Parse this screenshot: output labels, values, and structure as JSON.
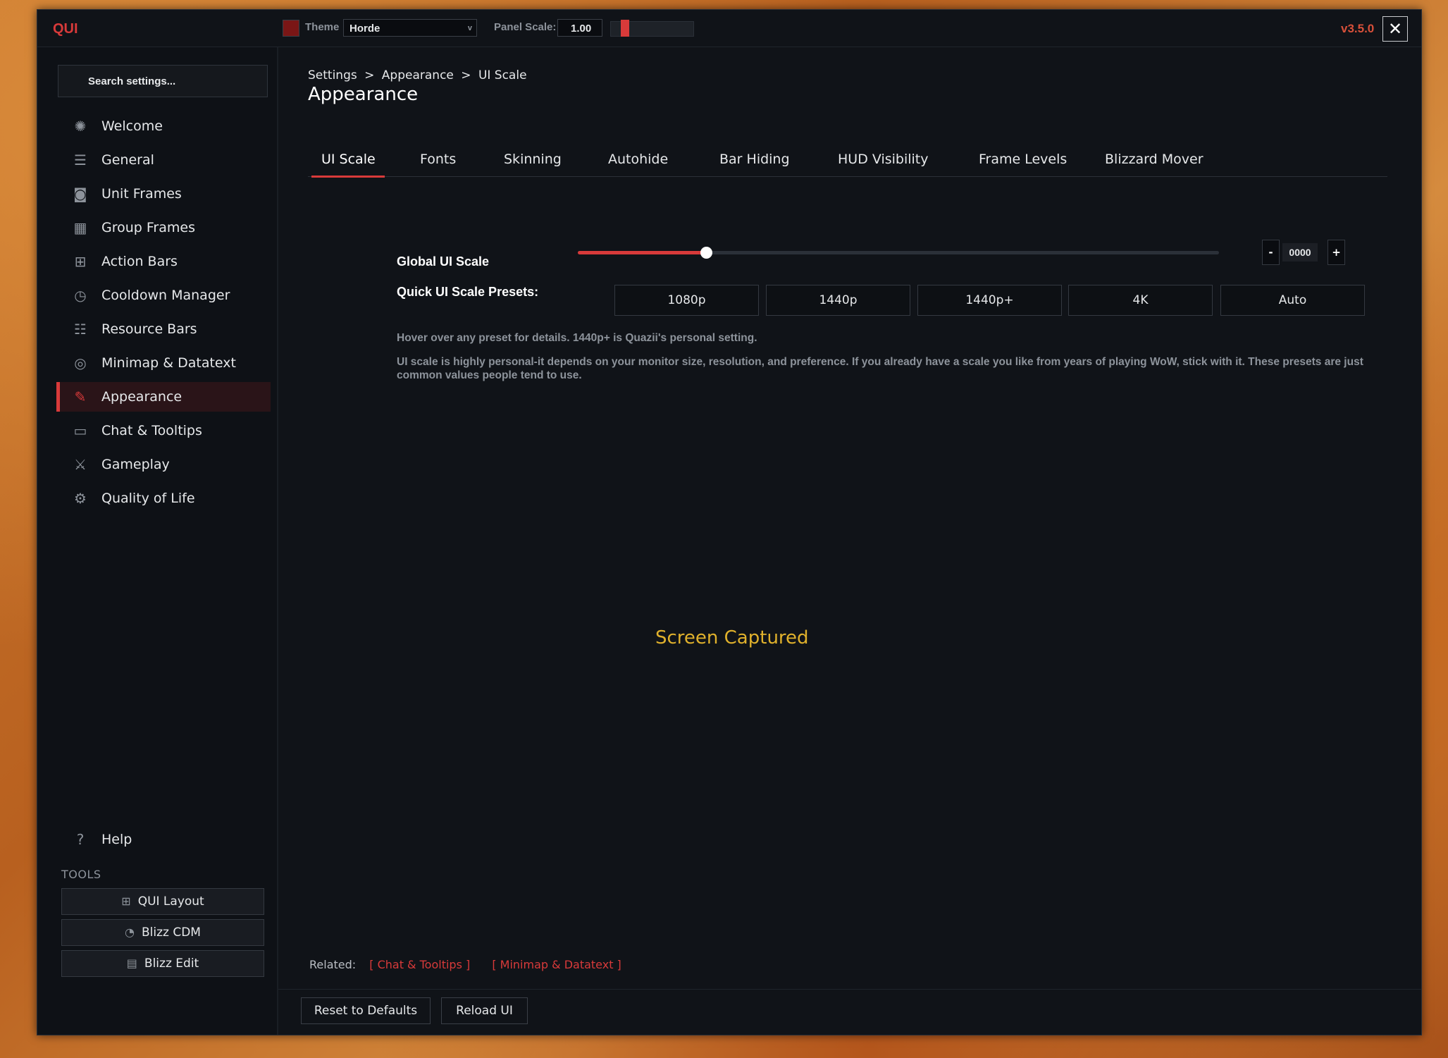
{
  "app": {
    "brand": "QUI",
    "version": "v3.5.0",
    "close_glyph": "✕"
  },
  "topbar": {
    "theme_label": "Theme",
    "theme_value": "Horde",
    "theme_color": "#7a1616",
    "panel_scale_label": "Panel Scale:",
    "panel_scale_value": "1.00",
    "panel_scale_fraction": 0.2
  },
  "sidebar": {
    "search_placeholder": "Search settings...",
    "items": [
      {
        "label": "Welcome",
        "icon": "sun-icon",
        "active": false
      },
      {
        "label": "General",
        "icon": "sliders-icon",
        "active": false
      },
      {
        "label": "Unit Frames",
        "icon": "portrait-icon",
        "active": false
      },
      {
        "label": "Group Frames",
        "icon": "group-icon",
        "active": false
      },
      {
        "label": "Action Bars",
        "icon": "action-bars-icon",
        "active": false
      },
      {
        "label": "Cooldown Manager",
        "icon": "clock-icon",
        "active": false
      },
      {
        "label": "Resource Bars",
        "icon": "list-icon",
        "active": false
      },
      {
        "label": "Minimap & Datatext",
        "icon": "compass-icon",
        "active": false
      },
      {
        "label": "Appearance",
        "icon": "brush-icon",
        "active": true
      },
      {
        "label": "Chat & Tooltips",
        "icon": "chat-icon",
        "active": false
      },
      {
        "label": "Gameplay",
        "icon": "swords-icon",
        "active": false
      },
      {
        "label": "Quality of Life",
        "icon": "gear-icon",
        "active": false
      }
    ],
    "help_label": "Help",
    "tools_label": "TOOLS",
    "tools": [
      {
        "label": "QUI Layout",
        "icon": "layout-icon"
      },
      {
        "label": "Blizz CDM",
        "icon": "cooldown-icon"
      },
      {
        "label": "Blizz Edit",
        "icon": "edit-icon"
      }
    ]
  },
  "main": {
    "breadcrumb": [
      "Settings",
      "Appearance",
      "UI Scale"
    ],
    "breadcrumb_sep": ">",
    "title": "Appearance",
    "tabs": [
      "UI Scale",
      "Fonts",
      "Skinning",
      "Autohide",
      "Bar Hiding",
      "HUD Visibility",
      "Frame Levels",
      "Blizzard Mover"
    ],
    "active_tab": "UI Scale",
    "global_ui_scale_label": "Global UI Scale",
    "global_ui_scale_value": "0000",
    "global_ui_scale_fraction": 0.2,
    "stepper_minus": "-",
    "stepper_plus": "+",
    "presets_label": "Quick UI Scale Presets:",
    "presets": [
      "1080p",
      "1440p",
      "1440p+",
      "4K",
      "Auto"
    ],
    "hint_1": "Hover over any preset for details. 1440p+ is Quazii's personal setting.",
    "hint_2": "UI scale is highly personal-it depends on your monitor size, resolution, and preference. If you already have a scale you like from years of playing WoW, stick with it. These presets are just common values people tend to use.",
    "overlay_text": "Screen Captured",
    "related_label": "Related:",
    "related_links": [
      "[ Chat & Tooltips ]",
      "[ Minimap & Datatext ]"
    ],
    "reset_label": "Reset to Defaults",
    "reload_label": "Reload UI"
  },
  "colors": {
    "accent": "#d83a3a",
    "overlay": "#e0b12c",
    "version": "#d8503a"
  }
}
